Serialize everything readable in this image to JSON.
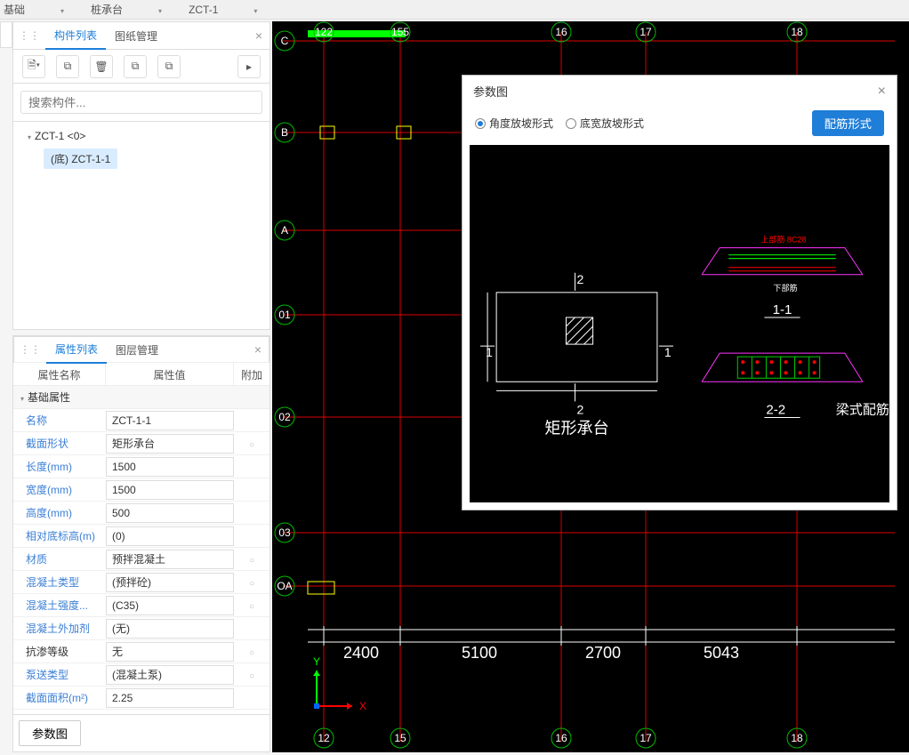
{
  "crumb": {
    "a": "基础",
    "b": "桩承台",
    "c": "ZCT-1"
  },
  "left_tabs": {
    "components": "构件列表",
    "drawings": "图纸管理"
  },
  "search": {
    "placeholder": "搜索构件..."
  },
  "tree": {
    "node1": "ZCT-1 <0>",
    "node2": "(底) ZCT-1-1"
  },
  "prop_tabs": {
    "attrs": "属性列表",
    "layers": "图层管理"
  },
  "prop_head": {
    "name": "属性名称",
    "value": "属性值",
    "extra": "附加"
  },
  "group1": "基础属性",
  "rows": [
    {
      "k": "名称",
      "v": "ZCT-1-1",
      "blue": true,
      "dot": false
    },
    {
      "k": "截面形状",
      "v": "矩形承台",
      "blue": true,
      "dot": true
    },
    {
      "k": "长度(mm)",
      "v": "1500",
      "blue": true,
      "dot": false
    },
    {
      "k": "宽度(mm)",
      "v": "1500",
      "blue": true,
      "dot": false
    },
    {
      "k": "高度(mm)",
      "v": "500",
      "blue": true,
      "dot": false
    },
    {
      "k": "相对底标高(m)",
      "v": "(0)",
      "blue": true,
      "dot": false
    },
    {
      "k": "材质",
      "v": "预拌混凝土",
      "blue": true,
      "dot": true
    },
    {
      "k": "混凝土类型",
      "v": "(预拌砼)",
      "blue": true,
      "dot": true
    },
    {
      "k": "混凝土强度...",
      "v": "(C35)",
      "blue": true,
      "dot": true
    },
    {
      "k": "混凝土外加剂",
      "v": "(无)",
      "blue": true,
      "dot": false
    },
    {
      "k": "抗渗等级",
      "v": "无",
      "blue": false,
      "dot": true
    },
    {
      "k": "泵送类型",
      "v": "(混凝土泵)",
      "blue": true,
      "dot": true
    },
    {
      "k": "截面面积(m²)",
      "v": "2.25",
      "blue": true,
      "dot": false
    }
  ],
  "footer_btn": "参数图",
  "dialog": {
    "title": "参数图",
    "radio1": "角度放坡形式",
    "radio2": "底宽放坡形式",
    "btn": "配筋形式"
  },
  "cad": {
    "grid_top": [
      "122",
      "155",
      "16",
      "17",
      "18"
    ],
    "grid_bottom": [
      "12",
      "15",
      "16",
      "17",
      "18"
    ],
    "grid_left": [
      "C",
      "B",
      "A",
      "01",
      "02",
      "03",
      "OA"
    ],
    "dims": [
      "2400",
      "5100",
      "2700",
      "5043"
    ],
    "axis_x": "X",
    "axis_y": "Y"
  },
  "diag": {
    "left_label": "矩形承台",
    "left_v1": "1",
    "left_v2": "1",
    "left_h1": "2",
    "left_h2": "2",
    "right_title1": "1-1",
    "right_title2": "2-2",
    "right_caption": "梁式配筋承台",
    "top_bar": "上部筋 8C28",
    "bot_bar": "下部筋"
  }
}
